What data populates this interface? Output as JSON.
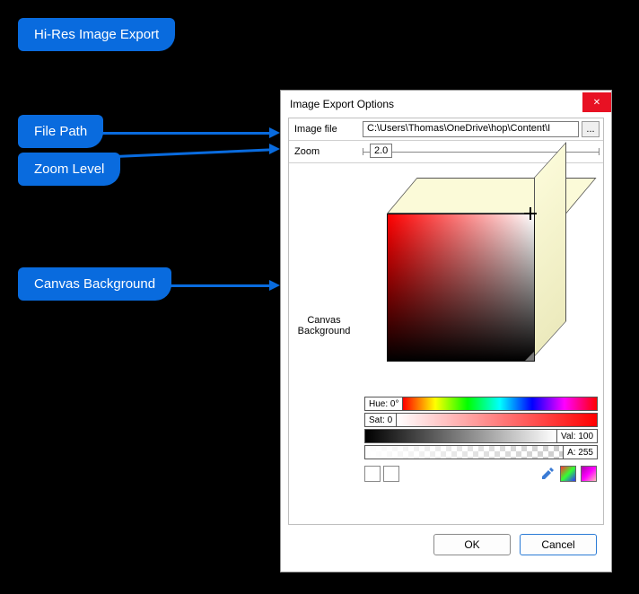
{
  "annotations": {
    "heading": "Hi-Res Image Export",
    "file_path": "File Path",
    "zoom_level": "Zoom Level",
    "canvas_bg": "Canvas Background"
  },
  "dialog": {
    "title": "Image Export Options",
    "labels": {
      "image_file": "Image file",
      "zoom": "Zoom",
      "canvas_bg_line1": "Canvas",
      "canvas_bg_line2": "Background"
    },
    "image_path": "C:\\Users\\Thomas\\OneDrive\\hop\\Content\\I",
    "browse": "...",
    "zoom_value": "2.0",
    "hsv": {
      "hue_label": "Hue: 0°",
      "sat_label": "Sat: 0",
      "val_label": "Val: 100",
      "alpha_label": "A: 255"
    },
    "buttons": {
      "ok": "OK",
      "cancel": "Cancel"
    }
  }
}
